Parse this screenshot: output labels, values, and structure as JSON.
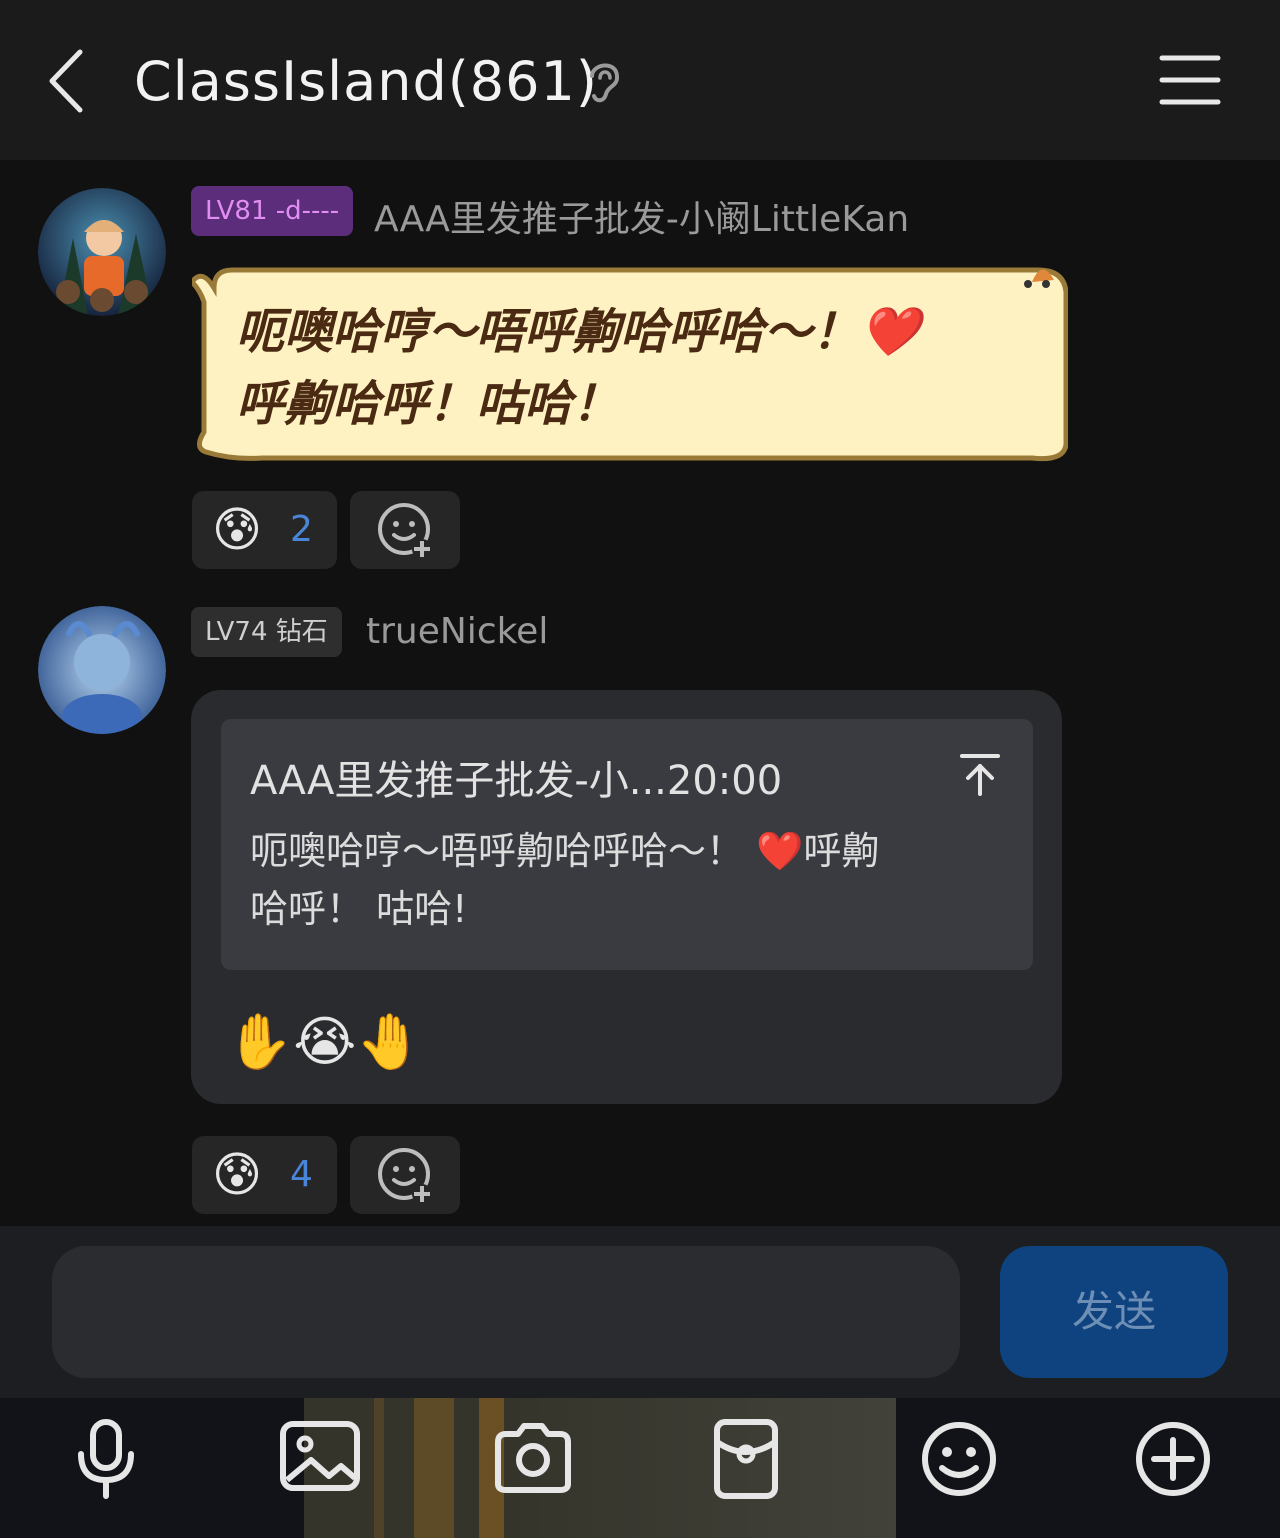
{
  "header": {
    "title": "ClassIsland(861)"
  },
  "messages": [
    {
      "badge": "LV81 -d----",
      "nickname": "AAA里发推子批发-小阚LittleKan",
      "text_line1": "呃噢哈哼～唔呼齁哈呼哈～！❤️",
      "text_line2": "呼齁哈呼！咕哈！",
      "reaction": {
        "emoji": "😰",
        "count": "2"
      }
    },
    {
      "badge": "LV74 钻石",
      "nickname": "trueNickel",
      "quote_header": "AAA里发推子批发-小...20:00",
      "quote_line1": "呃噢哈哼～唔呼齁哈呼哈～！ ❤️呼齁",
      "quote_line2": "哈呼！ 咕哈!",
      "emojis": "✋😭🤚",
      "reaction": {
        "emoji": "😰",
        "count": "4"
      }
    }
  ],
  "composer": {
    "send_label": "发送",
    "input_placeholder": ""
  },
  "toolbar_icons": [
    "microphone-icon",
    "image-icon",
    "camera-icon",
    "red-packet-icon",
    "emoji-icon",
    "plus-icon"
  ],
  "colors": {
    "background": "#111111",
    "header": "#1b1b1b",
    "badge_purple": "#5b2d7a",
    "send_button": "#0f437f",
    "reaction_count": "#4a86d8",
    "bubble_fill": "#fff2c2"
  }
}
